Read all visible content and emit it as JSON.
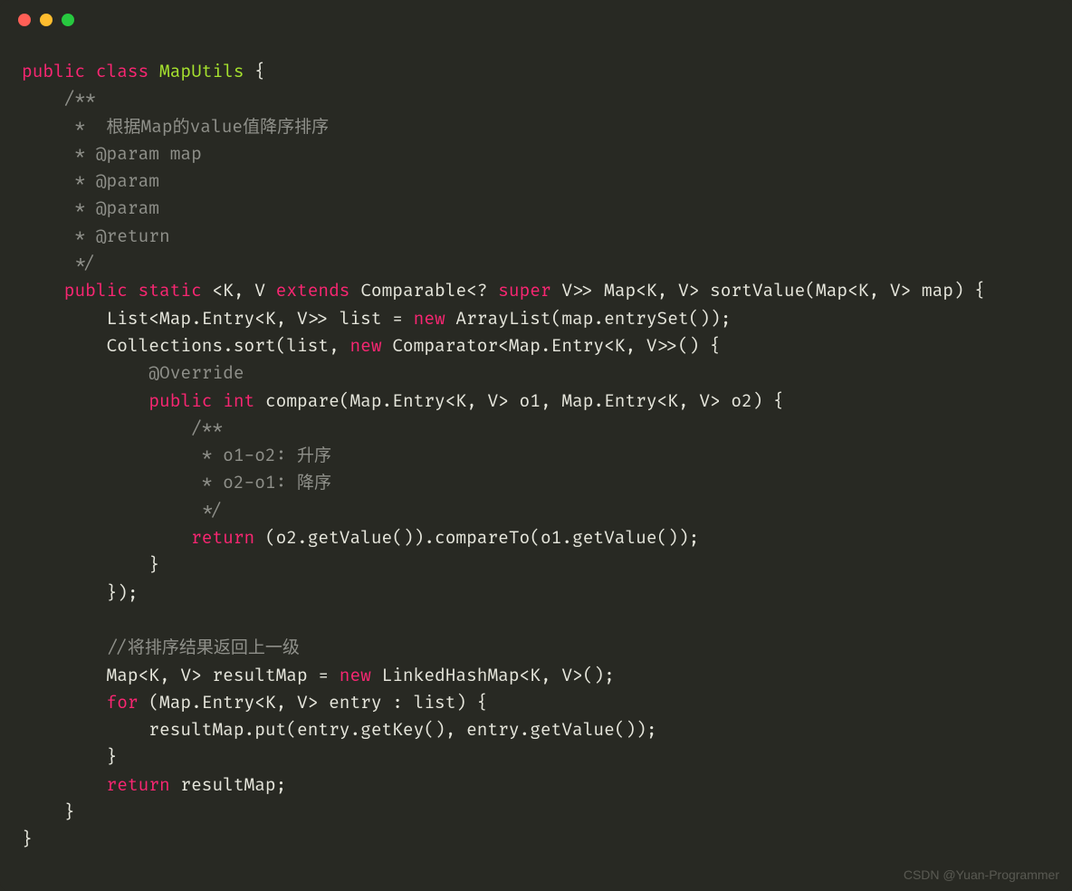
{
  "window": {
    "dots": [
      "red",
      "yellow",
      "green"
    ]
  },
  "watermark": "CSDN @Yuan-Programmer",
  "code": {
    "l1": {
      "kw_public": "public",
      "kw_class": "class",
      "name": "MapUtils",
      "rest": " {"
    },
    "l2": "    /**",
    "l3": "     *  根据Map的value值降序排序",
    "l4": "     * @param map",
    "l5": "     * @param",
    "l6": "     * @param",
    "l7": "     * @return",
    "l8": "     */",
    "l9": {
      "lead": "    ",
      "kw_public": "public",
      "kw_static": "static",
      "g1": " <K, V ",
      "kw_extends": "extends",
      "g2": " Comparable<? ",
      "kw_super": "super",
      "g3": " V>> Map<K, V> sortValue(Map<K, V> map) {"
    },
    "l10": {
      "lead": "        List<Map.Entry<K, V>> list = ",
      "kw_new": "new",
      "rest": " ArrayList(map.entrySet());"
    },
    "l11": {
      "lead": "        Collections.sort(list, ",
      "kw_new": "new",
      "rest": " Comparator<Map.Entry<K, V>>() {"
    },
    "l12": "            @Override",
    "l13": {
      "lead": "            ",
      "kw_public": "public",
      "sp": " ",
      "kw_int": "int",
      "rest": " compare(Map.Entry<K, V> o1, Map.Entry<K, V> o2) {"
    },
    "l14": "                /**",
    "l15": "                 * o1-o2: 升序",
    "l16": "                 * o2-o1: 降序",
    "l17": "                 */",
    "l18": {
      "lead": "                ",
      "kw_return": "return",
      "rest": " (o2.getValue()).compareTo(o1.getValue());"
    },
    "l19": "            }",
    "l20": "        });",
    "l21": "",
    "l22": "        //将排序结果返回上一级",
    "l23": {
      "lead": "        Map<K, V> resultMap = ",
      "kw_new": "new",
      "rest": " LinkedHashMap<K, V>();"
    },
    "l24": {
      "lead": "        ",
      "kw_for": "for",
      "rest": " (Map.Entry<K, V> entry : list) {"
    },
    "l25": "            resultMap.put(entry.getKey(), entry.getValue());",
    "l26": "        }",
    "l27": {
      "lead": "        ",
      "kw_return": "return",
      "rest": " resultMap;"
    },
    "l28": "    }",
    "l29": "}"
  }
}
